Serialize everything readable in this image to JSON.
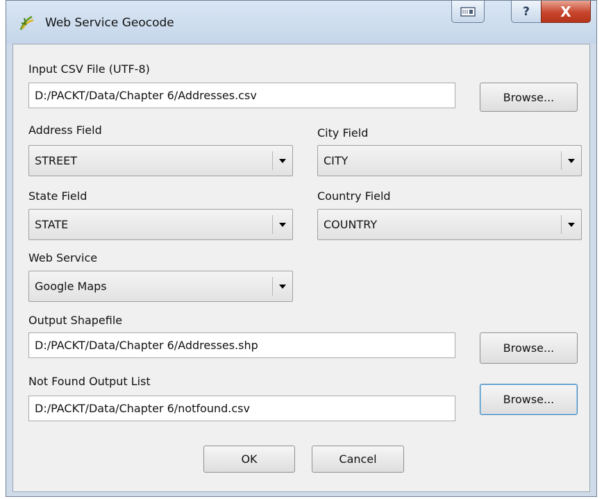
{
  "window": {
    "title": "Web Service Geocode",
    "close_glyph": "X",
    "help_glyph": "?"
  },
  "input_csv": {
    "label": "Input CSV File (UTF-8)",
    "value": "D:/PACKT/Data/Chapter 6/Addresses.csv",
    "browse_label": "Browse..."
  },
  "address_field": {
    "label": "Address Field",
    "value": "STREET"
  },
  "city_field": {
    "label": "City Field",
    "value": "CITY"
  },
  "state_field": {
    "label": "State Field",
    "value": "STATE"
  },
  "country_field": {
    "label": "Country Field",
    "value": "COUNTRY"
  },
  "web_service": {
    "label": "Web Service",
    "value": "Google Maps"
  },
  "output_shapefile": {
    "label": "Output Shapefile",
    "value": "D:/PACKT/Data/Chapter 6/Addresses.shp",
    "browse_label": "Browse..."
  },
  "not_found": {
    "label": "Not Found Output List",
    "value": "D:/PACKT/Data/Chapter 6/notfound.csv",
    "browse_label": "Browse..."
  },
  "buttons": {
    "ok": "OK",
    "cancel": "Cancel"
  },
  "icons": {
    "app": "qgis-icon",
    "keyboard": "keyboard-icon",
    "help": "help-icon",
    "close": "close-icon",
    "dropdown": "dropdown-arrow-icon"
  }
}
